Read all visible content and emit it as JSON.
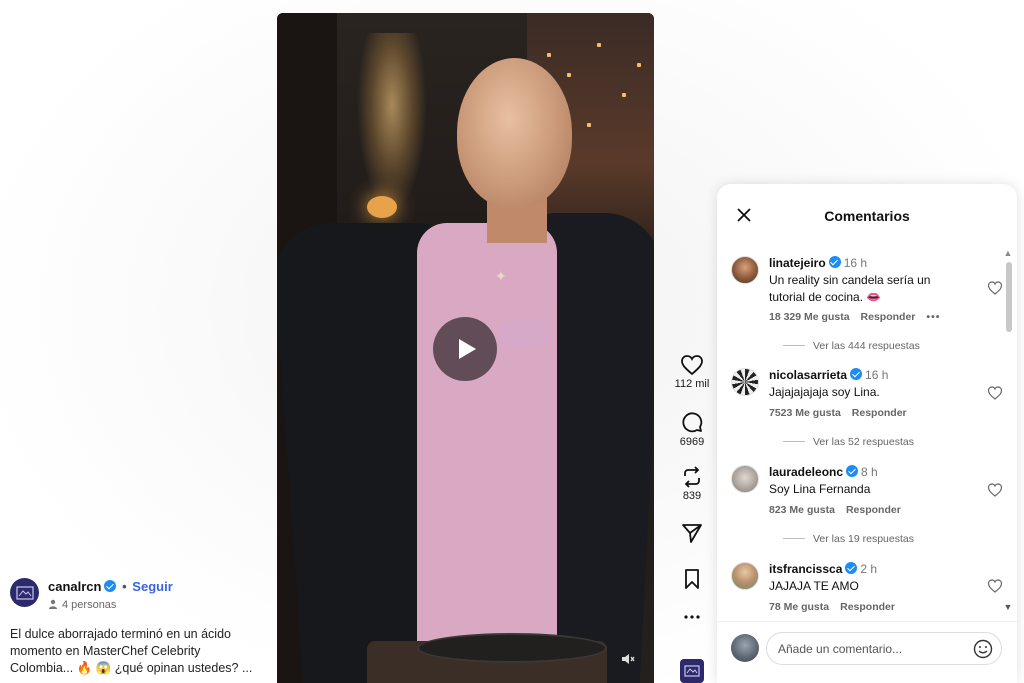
{
  "video": {
    "controls": {
      "play": "play-icon",
      "mute": "muted-speaker-icon"
    }
  },
  "rail": {
    "likes": "112 mil",
    "comments": "6969",
    "reposts": "839"
  },
  "post": {
    "author": "canalrcn",
    "separator": "•",
    "follow_label": "Seguir",
    "audience": "4 personas",
    "caption": "El dulce aborrajado terminó en un ácido momento en MasterChef Celebrity Colombia... 🔥 😱 ¿qué opinan ustedes? ..."
  },
  "comments_panel": {
    "title": "Comentarios",
    "input_placeholder": "Añade un comentario...",
    "comments": [
      {
        "user": "linatejeiro",
        "time": "16 h",
        "text": "Un reality sin candela sería un tutorial de cocina. 👄",
        "likes": "18 329 Me gusta",
        "reply_label": "Responder",
        "more": "•••",
        "replies": "Ver las 444 respuestas"
      },
      {
        "user": "nicolasarrieta",
        "time": "16 h",
        "text": "Jajajajajaja soy Lina.",
        "likes": "7523 Me gusta",
        "reply_label": "Responder",
        "replies": "Ver las 52 respuestas"
      },
      {
        "user": "lauradeleonc",
        "time": "8 h",
        "text": "Soy Lina Fernanda",
        "likes": "823 Me gusta",
        "reply_label": "Responder",
        "replies": "Ver las 19 respuestas"
      },
      {
        "user": "itsfrancissca",
        "time": "2 h",
        "text": "JAJAJA TE AMO",
        "likes": "78 Me gusta",
        "reply_label": "Responder"
      }
    ]
  },
  "colors": {
    "verified": "#1d8cf5",
    "follow_link": "#3b64e0",
    "channel_brand": "#2d2a6b"
  }
}
